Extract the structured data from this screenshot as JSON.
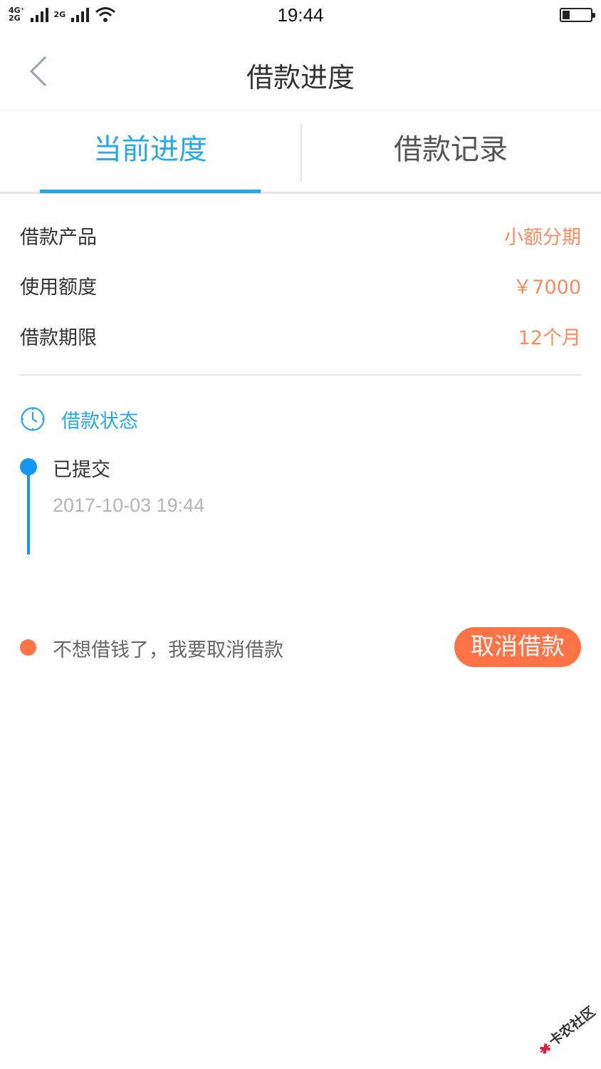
{
  "status_bar": {
    "network_1_top": "4G⁺",
    "network_1_bottom": "2G",
    "network_2": "2G",
    "time": "19:44"
  },
  "nav": {
    "title": "借款进度"
  },
  "tabs": [
    {
      "label": "当前进度",
      "active": true
    },
    {
      "label": "借款记录",
      "active": false
    }
  ],
  "loan_info": [
    {
      "label": "借款产品",
      "value": "小额分期"
    },
    {
      "label": "使用额度",
      "value": "￥7000"
    },
    {
      "label": "借款期限",
      "value": "12个月"
    }
  ],
  "loan_status": {
    "title": "借款状态",
    "steps": [
      {
        "status": "已提交",
        "time": "2017-10-03 19:44"
      }
    ]
  },
  "cancel": {
    "prompt": "不想借钱了，我要取消借款",
    "button": "取消借款"
  },
  "watermark": {
    "text": "卡农社区"
  },
  "colors": {
    "accent_blue": "#29a8e8",
    "timeline_blue": "#1296f0",
    "value_orange": "#ff8a5c",
    "button_orange": "#ff7346"
  }
}
